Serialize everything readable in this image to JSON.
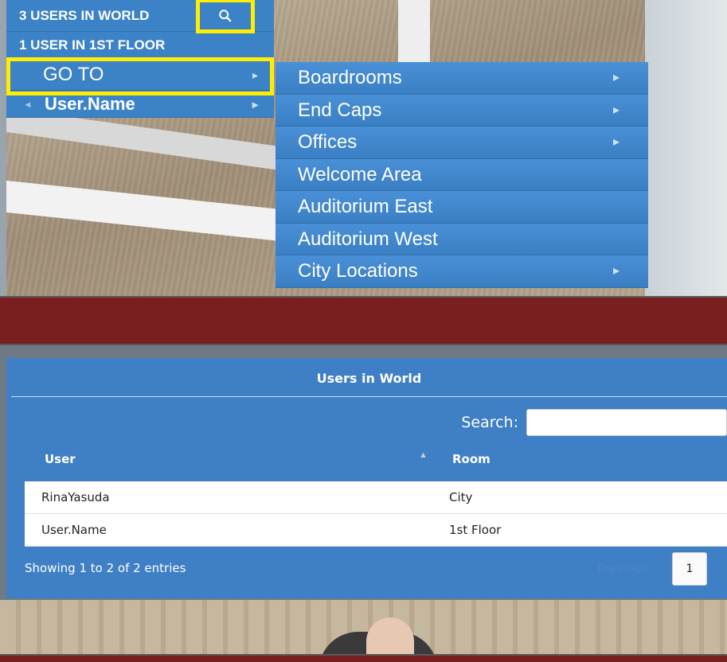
{
  "menu": {
    "users_in_world": "3 USERS IN WORLD",
    "users_in_floor": "1 USER IN 1ST FLOOR",
    "goto_label": "GO TO",
    "user_label": "User.Name"
  },
  "submenu": {
    "items": [
      {
        "label": "Boardrooms",
        "has_arrow": true
      },
      {
        "label": "End Caps",
        "has_arrow": true
      },
      {
        "label": "Offices",
        "has_arrow": true
      },
      {
        "label": "Welcome Area",
        "has_arrow": false
      },
      {
        "label": "Auditorium East",
        "has_arrow": false
      },
      {
        "label": "Auditorium West",
        "has_arrow": false
      },
      {
        "label": "City Locations",
        "has_arrow": true
      }
    ]
  },
  "dialog": {
    "title": "Users in World",
    "search_label": "Search:",
    "search_value": "",
    "columns": [
      "User",
      "Room"
    ],
    "rows": [
      {
        "user": "RinaYasuda",
        "room": "City"
      },
      {
        "user": "User.Name",
        "room": "1st Floor"
      }
    ],
    "info": "Showing 1 to 2 of 2 entries",
    "previous_label": "Previous",
    "page": "1"
  },
  "colors": {
    "menu_blue": "#3c82c7",
    "highlight": "#ffee00",
    "background_red": "#7a1f1f"
  },
  "icons": {
    "search": "search-icon",
    "chevron": "chevron-right-icon",
    "sort": "sort-asc-icon"
  }
}
